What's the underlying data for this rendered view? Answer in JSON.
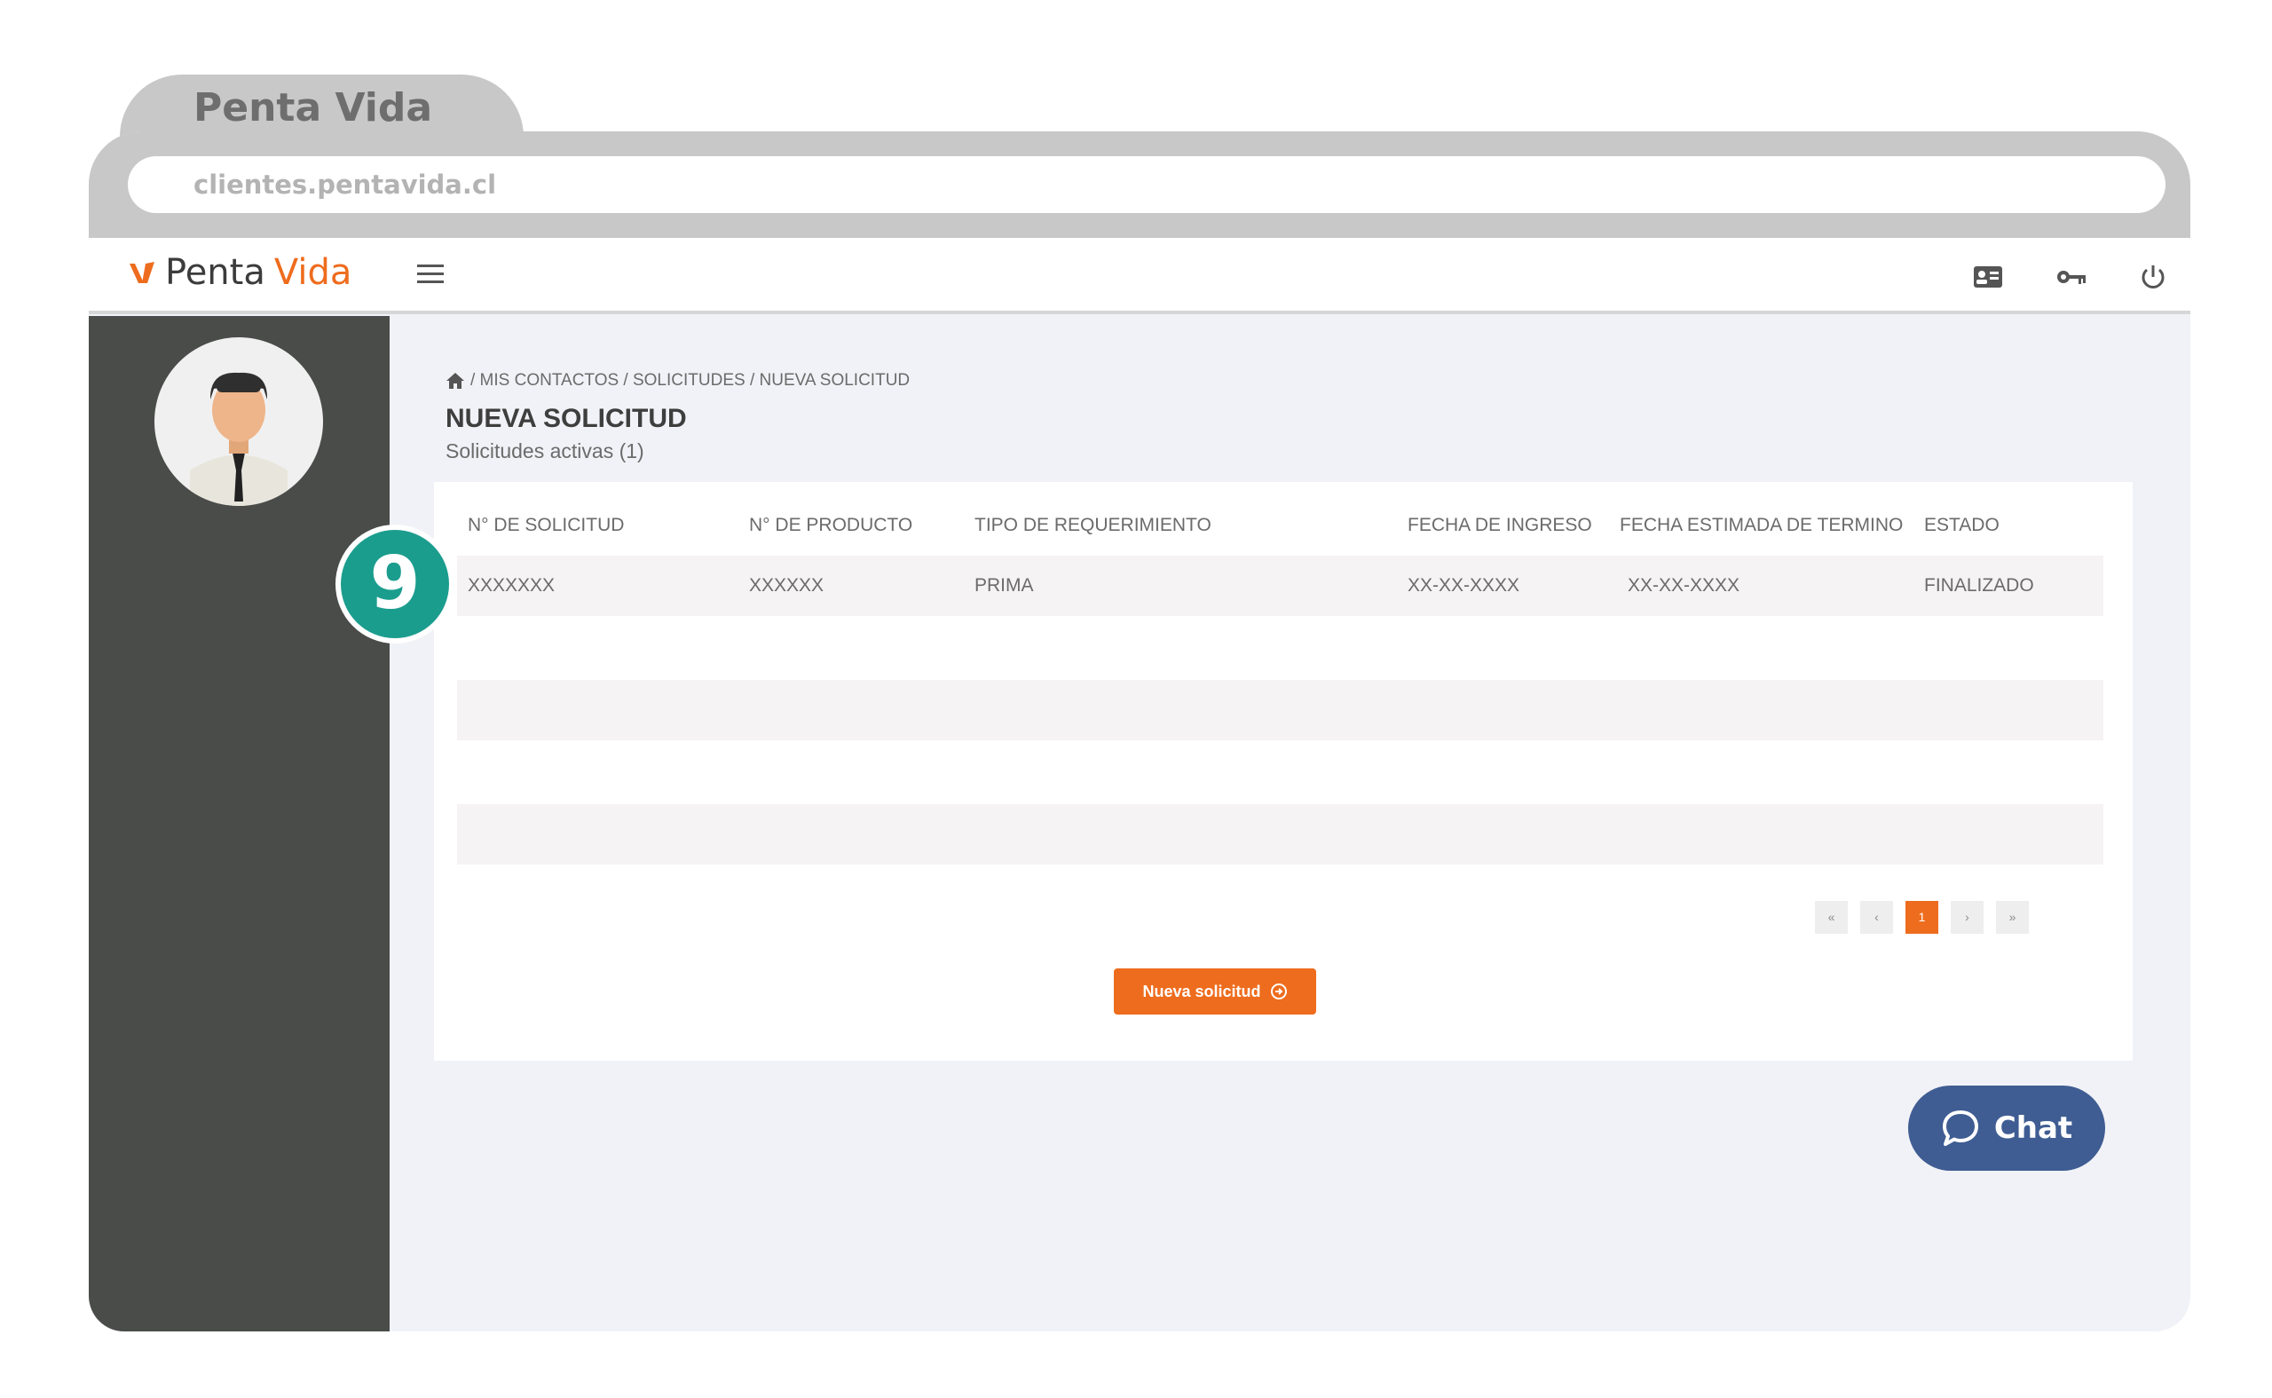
{
  "browser": {
    "tab_title": "Penta Vida",
    "url": "clientes.pentavida.cl"
  },
  "header": {
    "logo_penta": "Penta",
    "logo_vida": "Vida",
    "icons": [
      "menu-icon",
      "id-card-icon",
      "key-icon",
      "power-icon"
    ]
  },
  "breadcrumb": {
    "path": "/ MIS CONTACTOS / SOLICITUDES / NUEVA SOLICITUD"
  },
  "page": {
    "title": "NUEVA SOLICITUD",
    "subtitle": "Solicitudes activas (1)"
  },
  "table": {
    "columns": [
      "N° DE SOLICITUD",
      "N° DE PRODUCTO",
      "TIPO DE REQUERIMIENTO",
      "FECHA DE INGRESO",
      "FECHA ESTIMADA DE TERMINO",
      "ESTADO"
    ],
    "rows": [
      [
        "XXXXXXX",
        "XXXXXX",
        "PRIMA",
        "XX-XX-XXXX",
        "XX-XX-XXXX",
        "FINALIZADO"
      ]
    ]
  },
  "pagination": {
    "first": "«",
    "prev": "‹",
    "current": "1",
    "next": "›",
    "last": "»"
  },
  "actions": {
    "new_request": "Nueva solicitud"
  },
  "step_badge": "9",
  "chat": {
    "label": "Chat"
  },
  "colors": {
    "accent": "#ee6c1d",
    "sidebar": "#4a4c4a",
    "badge": "#1b9d8e",
    "chat": "#3f5d93"
  }
}
